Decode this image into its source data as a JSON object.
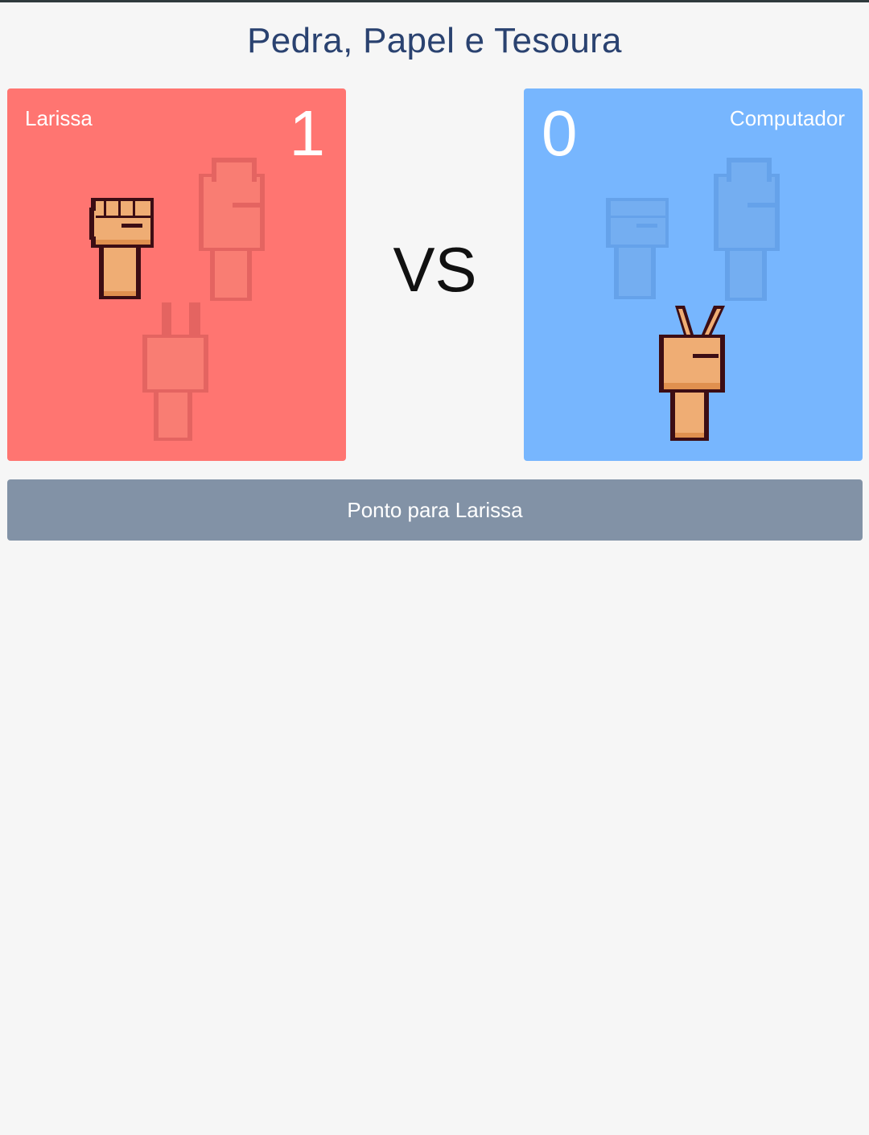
{
  "title": "Pedra, Papel e Tesoura",
  "player": {
    "name": "Larissa",
    "score": "1",
    "selected": "rock",
    "color": "#ff7571"
  },
  "computer": {
    "name": "Computador",
    "score": "0",
    "selected": "scissors",
    "color": "#77b6fe"
  },
  "vs_label": "VS",
  "result_button": "Ponto para Larissa",
  "icons": {
    "rock": "rock-hand-icon",
    "paper": "paper-hand-icon",
    "scissors": "scissors-hand-icon"
  },
  "colors": {
    "title": "#2a4270",
    "button": "#8292a6",
    "skin": "#efad74",
    "outline": "#3c0d14"
  }
}
